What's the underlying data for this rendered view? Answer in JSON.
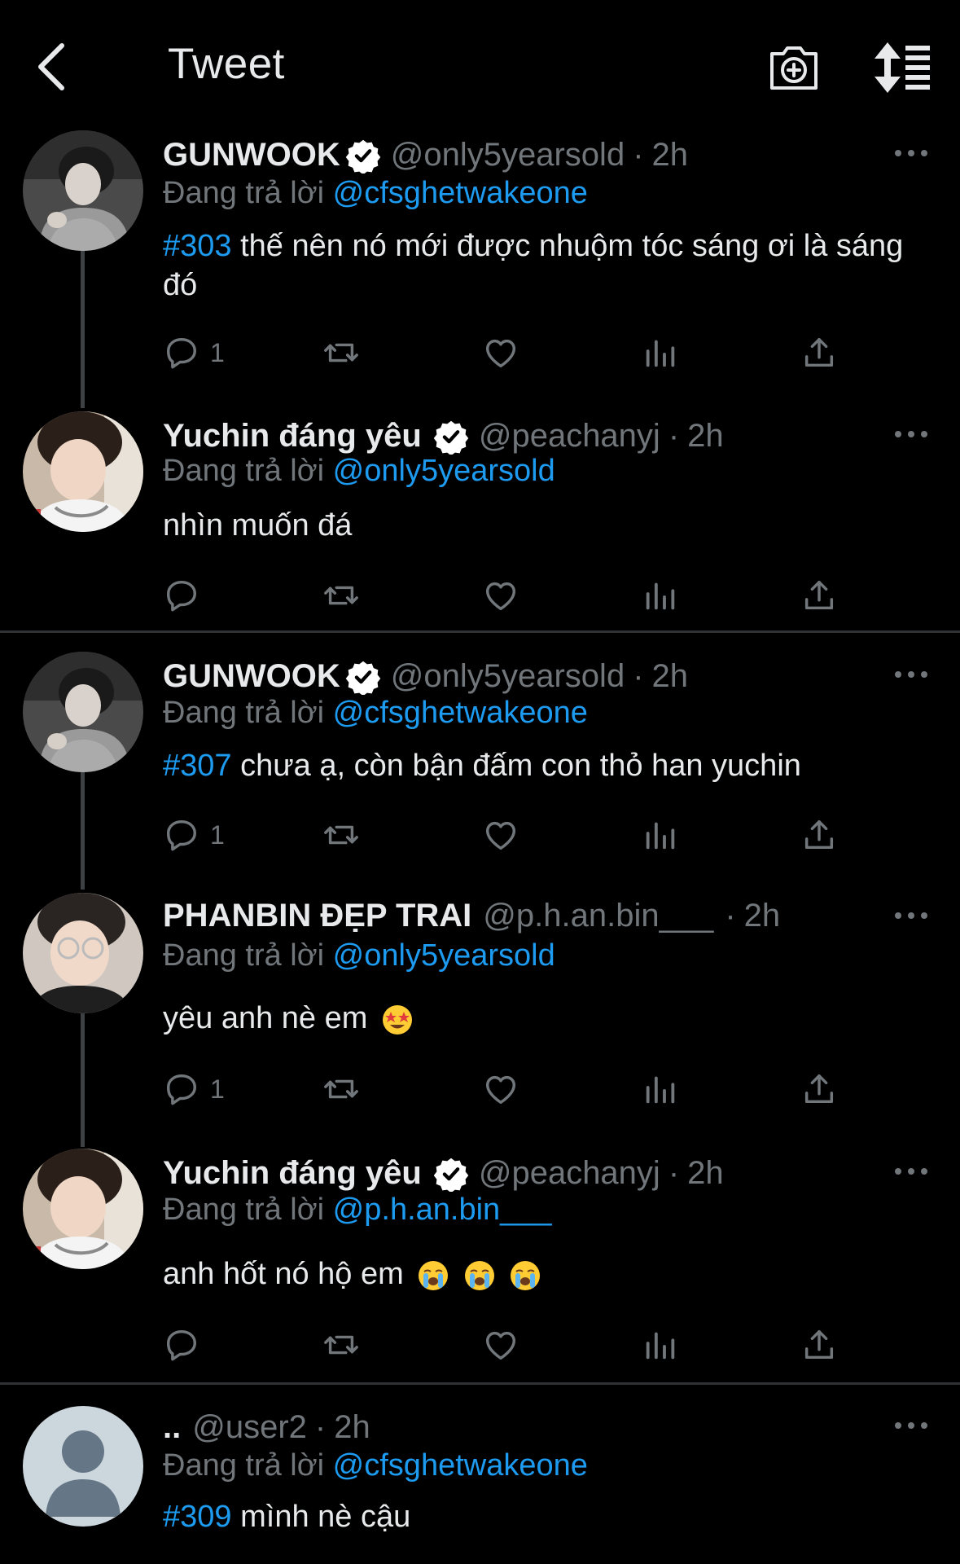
{
  "header": {
    "title": "Tweet",
    "back_icon": "chevron-left-icon",
    "camera_icon": "camera-plus-icon",
    "sort_icon": "sort-list-icon"
  },
  "colors": {
    "background": "#000000",
    "link": "#1d9bf0",
    "muted": "#71767b",
    "text": "#e7e9ea"
  },
  "reply_prefix": "Đang trả lời",
  "tweets": [
    {
      "name": "GUNWOOK",
      "verified": true,
      "handle": "@only5yearsold",
      "sep": "·",
      "time": "2h",
      "reply_to": "@cfsghetwakeone",
      "tag": "#303",
      "text": "thế nên nó mới được nhuộm tóc sáng ơi là sáng đó",
      "reply_count": "1"
    },
    {
      "name": "Yuchin đáng yêu",
      "verified": true,
      "handle": "@peachanyj",
      "sep": "·",
      "time": "2h",
      "reply_to": "@only5yearsold",
      "text": "nhìn muốn đá",
      "reply_count": ""
    },
    {
      "name": "GUNWOOK",
      "verified": true,
      "handle": "@only5yearsold",
      "sep": "·",
      "time": "2h",
      "reply_to": "@cfsghetwakeone",
      "tag": "#307",
      "text": "chưa ạ, còn bận đấm con thỏ han yuchin",
      "reply_count": "1"
    },
    {
      "name": "PHANBIN ĐẸP TRAI",
      "verified": false,
      "handle": "@p.h.an.bin___",
      "sep": "·",
      "time": "2h",
      "reply_to": "@only5yearsold",
      "text": "yêu anh nè em",
      "emoji": "star-struck-emoji",
      "reply_count": "1"
    },
    {
      "name": "Yuchin đáng yêu",
      "verified": true,
      "handle": "@peachanyj",
      "sep": "·",
      "time": "2h",
      "reply_to": "@p.h.an.bin___",
      "text": "anh hốt nó hộ em",
      "emoji": "loudly-crying-emoji",
      "reply_count": ""
    },
    {
      "name": "..",
      "verified": false,
      "handle": "@user2",
      "sep": "·",
      "time": "2h",
      "reply_to": "@cfsghetwakeone",
      "tag": "#309",
      "text": "mình nè cậu"
    }
  ],
  "action_icons": [
    "reply-icon",
    "retweet-icon",
    "like-icon",
    "views-icon",
    "share-icon"
  ]
}
